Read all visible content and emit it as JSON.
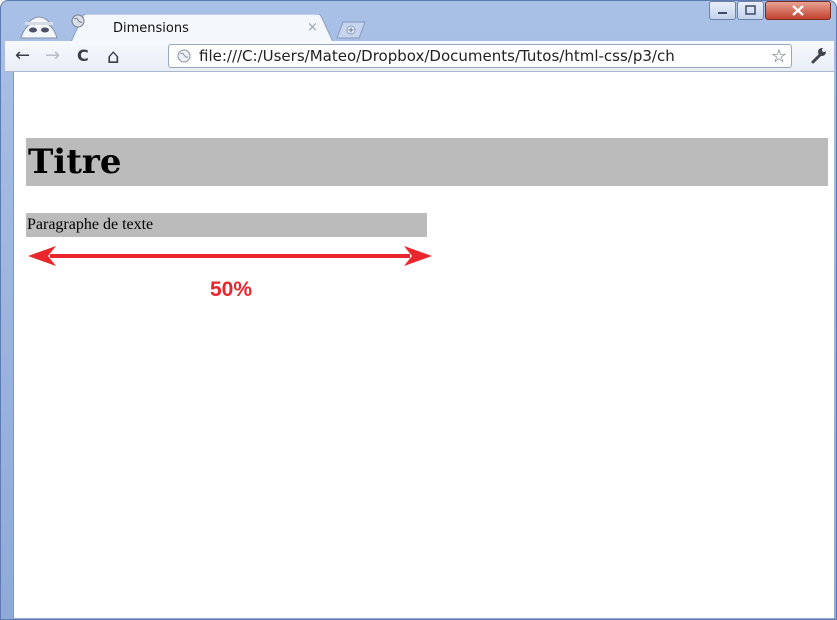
{
  "browser": {
    "tab_title": "Dimensions",
    "tab_close": "×",
    "url": "file:///C:/Users/Mateo/Dropbox/Documents/Tutos/html-css/p3/ch",
    "nav": {
      "back": "←",
      "forward": "→",
      "reload": "C",
      "home": "⌂"
    },
    "star": "☆",
    "icons": [
      "incognito-icon",
      "globe-icon",
      "new-tab-icon",
      "minimize-icon",
      "maximize-icon",
      "close-icon",
      "wrench-icon"
    ]
  },
  "page": {
    "heading": "Titre",
    "paragraph": "Paragraphe de texte",
    "annotation": "50%"
  },
  "colors": {
    "block_bg": "#bbbbbb",
    "annotation": "#e8262b"
  }
}
